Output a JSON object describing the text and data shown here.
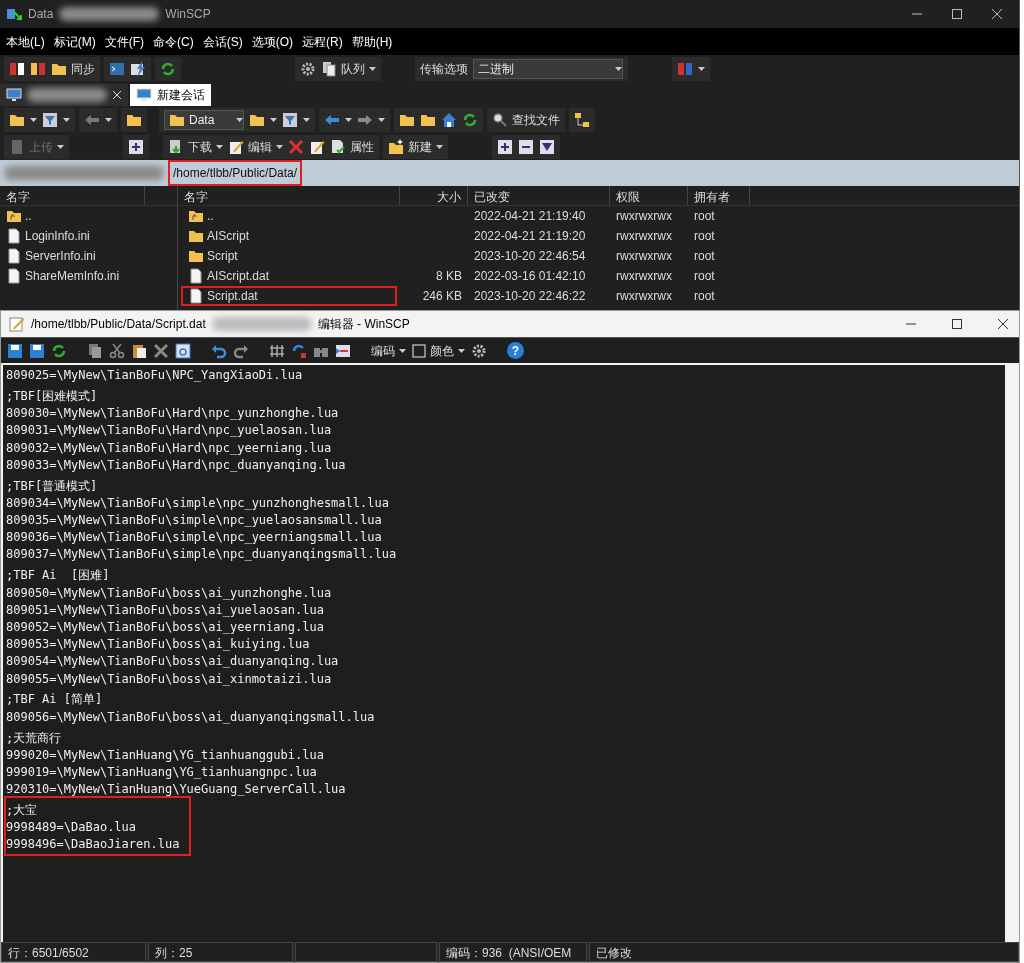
{
  "window": {
    "title_left": "Data",
    "title_right": "WinSCP"
  },
  "menu": [
    {
      "label": "本地(L)"
    },
    {
      "label": "标记(M)"
    },
    {
      "label": "文件(F)"
    },
    {
      "label": "命令(C)"
    },
    {
      "label": "会话(S)"
    },
    {
      "label": "选项(O)"
    },
    {
      "label": "远程(R)"
    },
    {
      "label": "帮助(H)"
    }
  ],
  "toolbar": {
    "sync": "同步",
    "queue": "队列",
    "transfer_label": "传输选项",
    "transfer_value": "二进制"
  },
  "tabs": [
    {
      "kind": "hidden",
      "selected": false
    },
    {
      "kind": "text",
      "label": "新建会话",
      "selected": true
    }
  ],
  "local_toolbar": {
    "upload": "上传"
  },
  "remote_toolbar": {
    "folder": "Data",
    "find": "查找文件",
    "download": "下载",
    "edit": "编辑",
    "properties": "属性",
    "new": "新建"
  },
  "remote_path": {
    "text": "/home/tlbb/Public/Data/",
    "highlighted": true
  },
  "local_panel": {
    "columns": [
      "名字"
    ],
    "files": [
      {
        "name": "..",
        "kind": "parent"
      },
      {
        "name": "LoginInfo.ini",
        "kind": "file"
      },
      {
        "name": "ServerInfo.ini",
        "kind": "file"
      },
      {
        "name": "ShareMemInfo.ini",
        "kind": "file"
      }
    ]
  },
  "remote_panel": {
    "columns": [
      "名字",
      "大小",
      "已改变",
      "权限",
      "拥有者"
    ],
    "files": [
      {
        "name": "..",
        "kind": "parent",
        "changed": "2022-04-21 21:19:40",
        "rights": "rwxrwxrwx",
        "owner": "root",
        "highlighted": false
      },
      {
        "name": "AIScript",
        "kind": "folder",
        "changed": "2022-04-21 21:19:20",
        "rights": "rwxrwxrwx",
        "owner": "root",
        "highlighted": false
      },
      {
        "name": "Script",
        "kind": "folder",
        "changed": "2023-10-20 22:46:54",
        "rights": "rwxrwxrwx",
        "owner": "root",
        "highlighted": false
      },
      {
        "name": "AIScript.dat",
        "kind": "file",
        "size": "8 KB",
        "changed": "2022-03-16 01:42:10",
        "rights": "rwxrwxrwx",
        "owner": "root",
        "highlighted": false
      },
      {
        "name": "Script.dat",
        "kind": "file",
        "size": "246 KB",
        "changed": "2023-10-20 22:46:22",
        "rights": "rwxrwxrwx",
        "owner": "root",
        "highlighted": true
      }
    ]
  },
  "editor": {
    "title": "/home/tlbb/Public/Data/Script.dat",
    "title_right": "编辑器 - WinSCP",
    "toolbar": {
      "encoding": "编码",
      "color_label": "颜色",
      "help": "?"
    },
    "lines": [
      {
        "text": "809025=\\MyNew\\TianBoFu\\NPC_YangXiaoDi.lua",
        "kind": "entry"
      },
      {
        "text": ";TBF[困难模式]",
        "kind": "comment"
      },
      {
        "text": "809030=\\MyNew\\TianBoFu\\Hard\\npc_yunzhonghe.lua",
        "kind": "entry"
      },
      {
        "text": "809031=\\MyNew\\TianBoFu\\Hard\\npc_yuelaosan.lua",
        "kind": "entry"
      },
      {
        "text": "809032=\\MyNew\\TianBoFu\\Hard\\npc_yeerniang.lua",
        "kind": "entry"
      },
      {
        "text": "809033=\\MyNew\\TianBoFu\\Hard\\npc_duanyanqing.lua",
        "kind": "entry"
      },
      {
        "text": ";TBF[普通模式]",
        "kind": "comment"
      },
      {
        "text": "809034=\\MyNew\\TianBoFu\\simple\\npc_yunzhonghesmall.lua",
        "kind": "entry"
      },
      {
        "text": "809035=\\MyNew\\TianBoFu\\simple\\npc_yuelaosansmall.lua",
        "kind": "entry"
      },
      {
        "text": "809036=\\MyNew\\TianBoFu\\simple\\npc_yeerniangsmall.lua",
        "kind": "entry"
      },
      {
        "text": "809037=\\MyNew\\TianBoFu\\simple\\npc_duanyanqingsmall.lua",
        "kind": "entry"
      },
      {
        "text": ";TBF Ai  [困难]",
        "kind": "comment"
      },
      {
        "text": "809050=\\MyNew\\TianBoFu\\boss\\ai_yunzhonghe.lua",
        "kind": "entry"
      },
      {
        "text": "809051=\\MyNew\\TianBoFu\\boss\\ai_yuelaosan.lua",
        "kind": "entry"
      },
      {
        "text": "809052=\\MyNew\\TianBoFu\\boss\\ai_yeerniang.lua",
        "kind": "entry"
      },
      {
        "text": "809053=\\MyNew\\TianBoFu\\boss\\ai_kuiying.lua",
        "kind": "entry"
      },
      {
        "text": "809054=\\MyNew\\TianBoFu\\boss\\ai_duanyanqing.lua",
        "kind": "entry"
      },
      {
        "text": "809055=\\MyNew\\TianBoFu\\boss\\ai_xinmotaizi.lua",
        "kind": "entry"
      },
      {
        "text": ";TBF Ai [简单]",
        "kind": "comment"
      },
      {
        "text": "809056=\\MyNew\\TianBoFu\\boss\\ai_duanyanqingsmall.lua",
        "kind": "entry"
      },
      {
        "text": ";天荒商行",
        "kind": "comment"
      },
      {
        "text": "999020=\\MyNew\\TianHuang\\YG_tianhuanggubi.lua",
        "kind": "entry"
      },
      {
        "text": "999019=\\MyNew\\TianHuang\\YG_tianhuangnpc.lua",
        "kind": "entry"
      },
      {
        "text": "920310=\\MyNew\\TianHuang\\YueGuang_ServerCall.lua",
        "kind": "entry"
      }
    ],
    "highlighted_lines": [
      {
        "text": ";大宝",
        "kind": "comment"
      },
      {
        "text": "9998489=\\DaBao.lua",
        "kind": "entry"
      },
      {
        "text": "9998496=\\DaBaoJiaren.lua",
        "kind": "entry"
      }
    ]
  },
  "status_bar": [
    {
      "text": "行：6501/6502"
    },
    {
      "text": "列：25"
    },
    {
      "text": "编码：936  (ANSI/OEM"
    },
    {
      "text": "已修改"
    }
  ]
}
